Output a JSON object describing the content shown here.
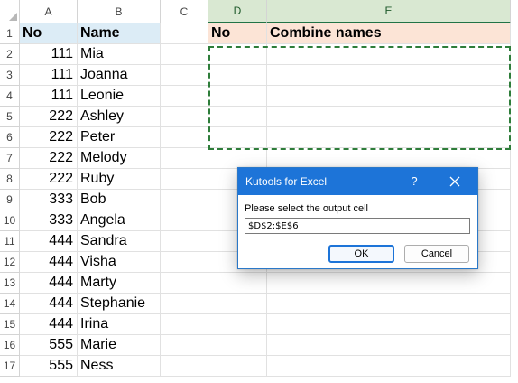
{
  "columns": [
    {
      "key": "A",
      "label": "A"
    },
    {
      "key": "B",
      "label": "B"
    },
    {
      "key": "C",
      "label": "C"
    },
    {
      "key": "D",
      "label": "D"
    },
    {
      "key": "E",
      "label": "E"
    }
  ],
  "rows": [
    "1",
    "2",
    "3",
    "4",
    "5",
    "6",
    "7",
    "8",
    "9",
    "10",
    "11",
    "12",
    "13",
    "14",
    "15",
    "16",
    "17"
  ],
  "header_row": {
    "A": "No",
    "B": "Name",
    "D": "No",
    "E": "Combine names"
  },
  "data": [
    {
      "A": "111",
      "B": "Mia"
    },
    {
      "A": "111",
      "B": "Joanna"
    },
    {
      "A": "111",
      "B": "Leonie"
    },
    {
      "A": "222",
      "B": "Ashley"
    },
    {
      "A": "222",
      "B": "Peter"
    },
    {
      "A": "222",
      "B": "Melody"
    },
    {
      "A": "222",
      "B": "Ruby"
    },
    {
      "A": "333",
      "B": "Bob"
    },
    {
      "A": "333",
      "B": "Angela"
    },
    {
      "A": "444",
      "B": "Sandra"
    },
    {
      "A": "444",
      "B": "Visha"
    },
    {
      "A": "444",
      "B": "Marty"
    },
    {
      "A": "444",
      "B": "Stephanie"
    },
    {
      "A": "444",
      "B": "Irina"
    },
    {
      "A": "555",
      "B": "Marie"
    },
    {
      "A": "555",
      "B": "Ness"
    }
  ],
  "selected_columns": [
    "D",
    "E"
  ],
  "dialog": {
    "title": "Kutools for Excel",
    "help_label": "?",
    "prompt": "Please select the output cell",
    "value": "$D$2:$E$6",
    "ok_label": "OK",
    "cancel_label": "Cancel"
  },
  "colors": {
    "header_fill_ab": "#dcecf6",
    "header_fill_de": "#fce4d6",
    "selection_border": "#2e7d3a",
    "dialog_title_bar": "#1d74d8"
  }
}
